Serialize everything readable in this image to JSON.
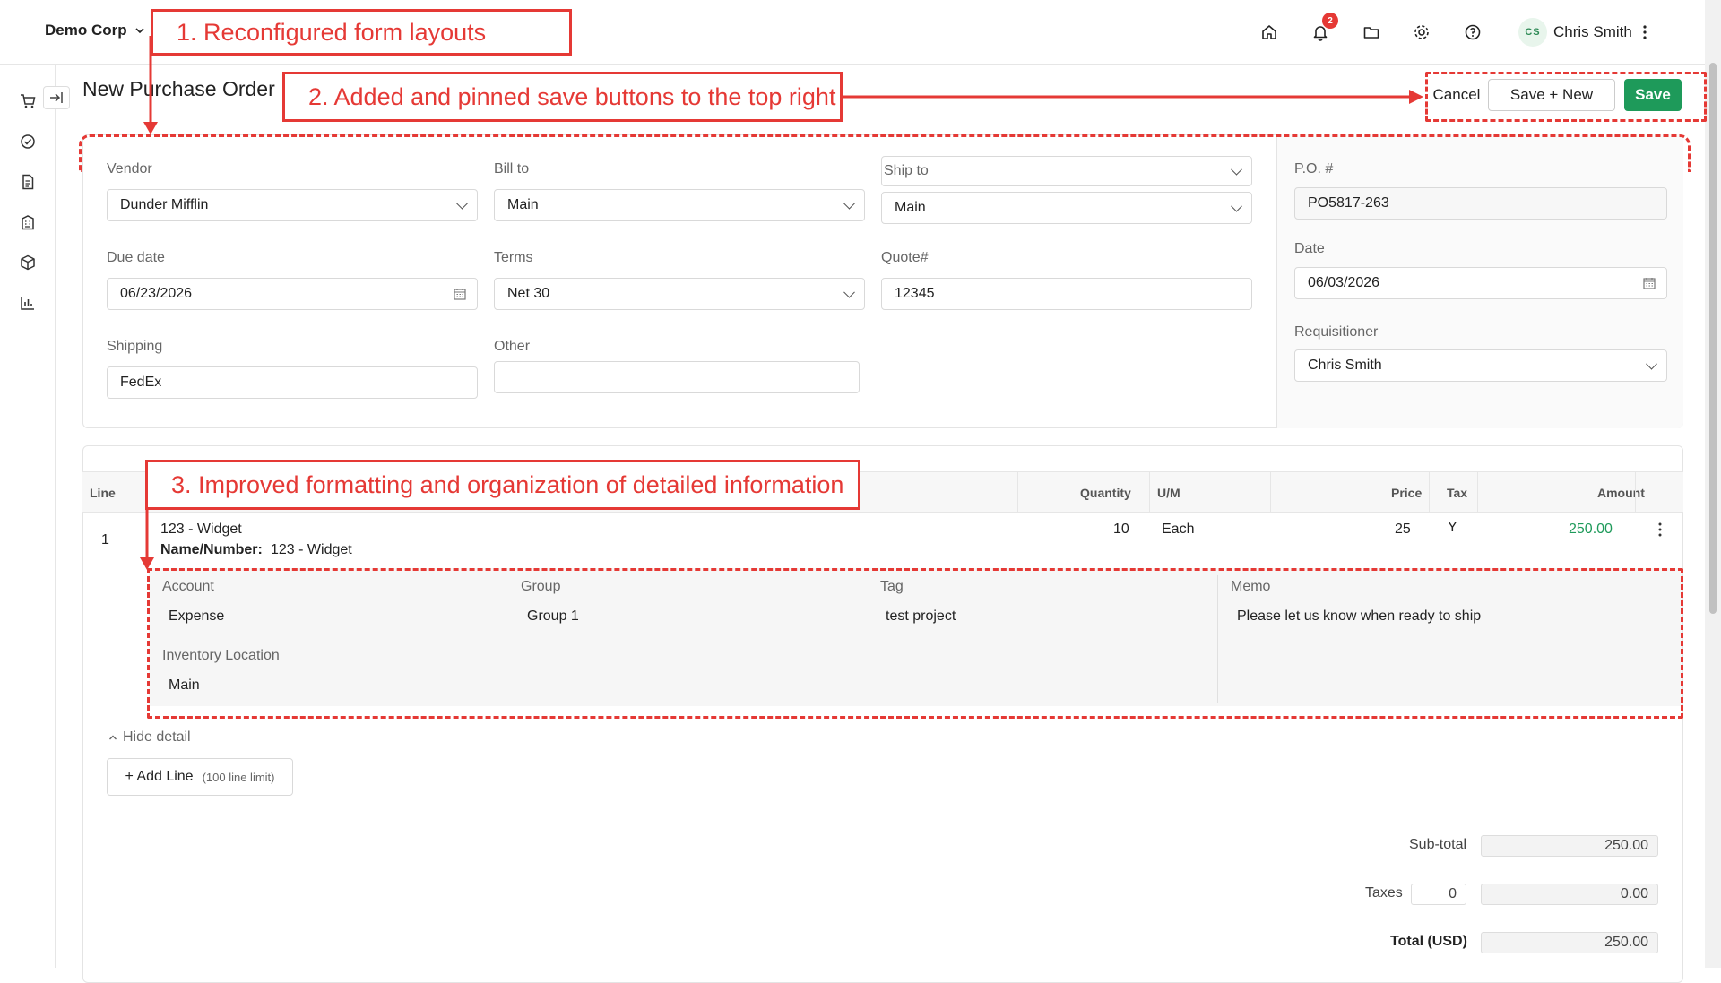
{
  "header": {
    "company": "Demo Corp",
    "notifications_count": "2",
    "user_initials": "CS",
    "user_name": "Chris Smith"
  },
  "page": {
    "title": "New Purchase Order",
    "cancel_label": "Cancel",
    "save_new_label": "Save + New",
    "save_label": "Save"
  },
  "form": {
    "vendor": {
      "label": "Vendor",
      "value": "Dunder Mifflin"
    },
    "bill_to": {
      "label": "Bill to",
      "value": "Main"
    },
    "ship_to": {
      "label": "Ship to",
      "value": "Main"
    },
    "due_date": {
      "label": "Due date",
      "value": "06/23/2026"
    },
    "terms": {
      "label": "Terms",
      "value": "Net 30"
    },
    "quote": {
      "label": "Quote#",
      "value": "12345"
    },
    "shipping": {
      "label": "Shipping",
      "value": "FedEx"
    },
    "other": {
      "label": "Other",
      "value": ""
    },
    "po_number": {
      "label": "P.O. #",
      "value": "PO5817-263"
    },
    "date": {
      "label": "Date",
      "value": "06/03/2026"
    },
    "requisitioner": {
      "label": "Requisitioner",
      "value": "Chris Smith"
    }
  },
  "lines": {
    "columns": {
      "line": "Line",
      "quantity": "Quantity",
      "um": "U/M",
      "price": "Price",
      "tax": "Tax",
      "amount": "Amount"
    },
    "rows": [
      {
        "line": "1",
        "item": "123 - Widget",
        "name_number_label": "Name/Number:",
        "name_number": "123 - Widget",
        "quantity": "10",
        "um": "Each",
        "price": "25",
        "tax": "Y",
        "amount": "250.00",
        "detail": {
          "account_label": "Account",
          "account": "Expense",
          "group_label": "Group",
          "group": "Group 1",
          "tag_label": "Tag",
          "tag": "test project",
          "memo_label": "Memo",
          "memo": "Please let us know when ready to ship",
          "inventory_label": "Inventory Location",
          "inventory": "Main"
        }
      }
    ],
    "hide_detail": "Hide detail",
    "add_line": "+ Add Line",
    "add_line_limit": "(100 line limit)"
  },
  "totals": {
    "subtotal_label": "Sub-total",
    "subtotal": "250.00",
    "taxes_label": "Taxes",
    "taxes_rate": "0",
    "taxes": "0.00",
    "total_label": "Total (USD)",
    "total": "250.00"
  },
  "annotations": {
    "a1": "1.  Reconfigured form layouts",
    "a2": "2.  Added and pinned save buttons to the top right",
    "a3": "3.  Improved formatting and organization of detailed information"
  },
  "colors": {
    "accent": "#1e9a5a",
    "annotation": "#e53935",
    "amount": "#1e9a5a"
  }
}
